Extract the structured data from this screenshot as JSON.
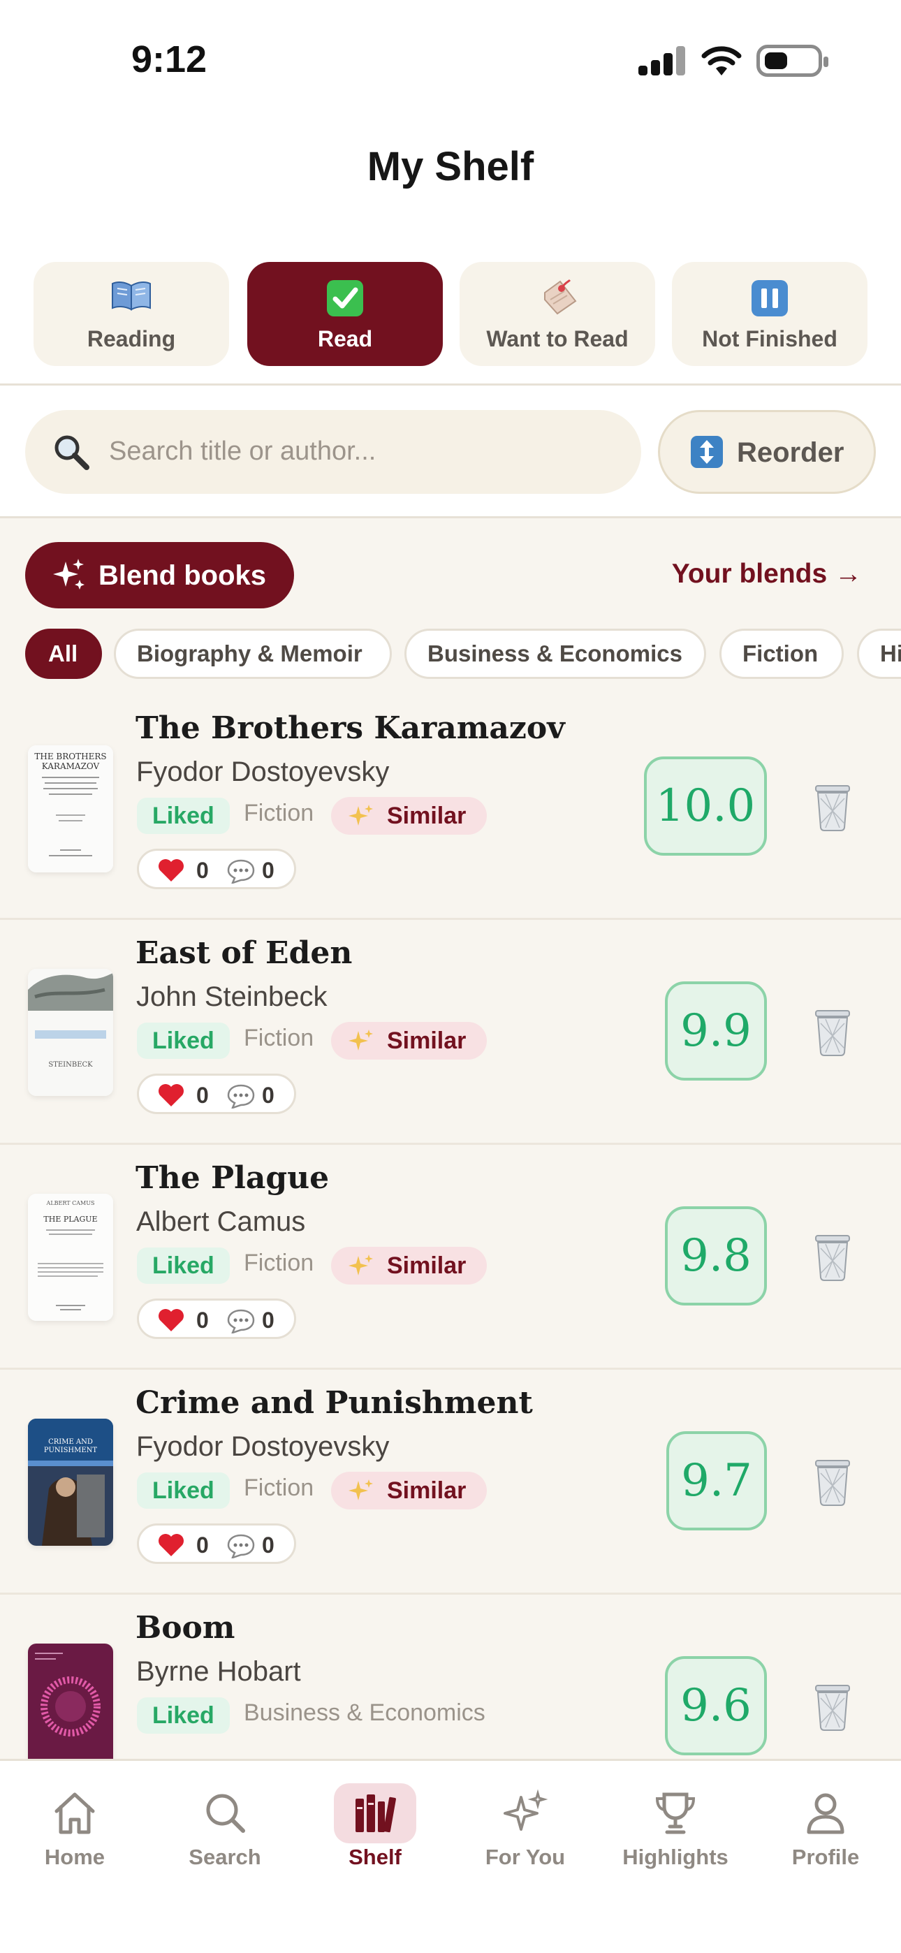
{
  "status_bar": {
    "time": "9:12"
  },
  "header": {
    "title": "My Shelf"
  },
  "tabs": [
    {
      "label": "Reading",
      "icon": "open-book-icon",
      "active": false
    },
    {
      "label": "Read",
      "icon": "check-mark-icon",
      "active": true
    },
    {
      "label": "Want to Read",
      "icon": "bookmark-tag-icon",
      "active": false
    },
    {
      "label": "Not Finished",
      "icon": "pause-icon",
      "active": false
    }
  ],
  "search": {
    "placeholder": "Search title or author...",
    "icon": "search-icon"
  },
  "reorder": {
    "label": "Reorder",
    "icon": "up-down-arrow-icon"
  },
  "blend": {
    "button_label": "Blend books",
    "link_label": "Your blends →"
  },
  "filters": [
    "All",
    "Biography & Memoir",
    "Business & Economics",
    "Fiction",
    "Hi"
  ],
  "books": [
    {
      "title": "The Brothers Karamazov",
      "author": "Fyodor Dostoyevsky",
      "status": "Liked",
      "genre": "Fiction",
      "similar": "Similar",
      "likes": "0",
      "comments": "0",
      "score": "10.0"
    },
    {
      "title": "East of Eden",
      "author": "John Steinbeck",
      "status": "Liked",
      "genre": "Fiction",
      "similar": "Similar",
      "likes": "0",
      "comments": "0",
      "score": "9.9"
    },
    {
      "title": "The Plague",
      "author": "Albert Camus",
      "status": "Liked",
      "genre": "Fiction",
      "similar": "Similar",
      "likes": "0",
      "comments": "0",
      "score": "9.8"
    },
    {
      "title": "Crime and Punishment",
      "author": "Fyodor Dostoyevsky",
      "status": "Liked",
      "genre": "Fiction",
      "similar": "Similar",
      "likes": "0",
      "comments": "0",
      "score": "9.7"
    },
    {
      "title": "Boom",
      "author": "Byrne Hobart",
      "status": "Liked",
      "genre": "Business & Economics",
      "score": "9.6"
    }
  ],
  "nav": [
    {
      "label": "Home",
      "icon": "home-icon"
    },
    {
      "label": "Search",
      "icon": "search-icon"
    },
    {
      "label": "Shelf",
      "icon": "bookshelf-icon",
      "active": true
    },
    {
      "label": "For You",
      "icon": "sparkles-icon"
    },
    {
      "label": "Highlights",
      "icon": "trophy-icon"
    },
    {
      "label": "Profile",
      "icon": "person-icon"
    }
  ],
  "colors": {
    "accent": "#72111f",
    "score_green": "#1fa968",
    "background": "#f8f5ef"
  }
}
